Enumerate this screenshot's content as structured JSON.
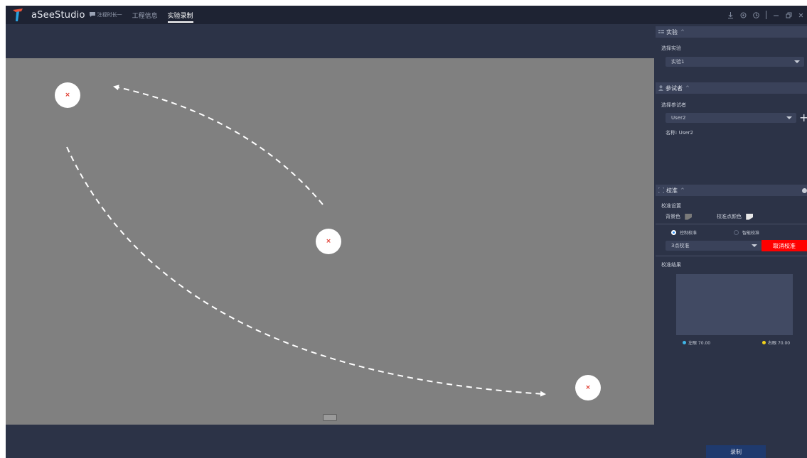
{
  "titlebar": {
    "app_name": "aSeeStudio",
    "sub_info": "注视时长一",
    "tabs": [
      {
        "label": "工程信息",
        "active": false
      },
      {
        "label": "实验录制",
        "active": true
      }
    ],
    "icons": [
      "download-icon",
      "settings-icon",
      "help-icon",
      "minimize-icon",
      "restore-icon",
      "close-icon"
    ]
  },
  "stage": {
    "background": "#808080",
    "target_marker": "×",
    "targets": [
      "top-left",
      "center",
      "bottom-right"
    ]
  },
  "panel": {
    "experiment": {
      "title": "实验",
      "select_label": "选择实验",
      "selected": "实验1"
    },
    "participant": {
      "title": "参试者",
      "select_label": "选择参试者",
      "selected": "User2",
      "name_line": "名称: User2"
    },
    "calibration": {
      "title": "校准",
      "settings_label": "校准设置",
      "background_color_label": "背景色",
      "point_color_label": "校准点颜色",
      "mode_manual": "控制校准",
      "mode_smart": "智能校准",
      "points_selected": "3点校准",
      "cancel_label": "取消校准",
      "result_label": "校准结果",
      "left_eye": "左眼 70.00",
      "right_eye": "右眼 70.00",
      "left_color": "#3fb6e8",
      "right_color": "#f2d21b"
    },
    "record_label": "录制"
  }
}
